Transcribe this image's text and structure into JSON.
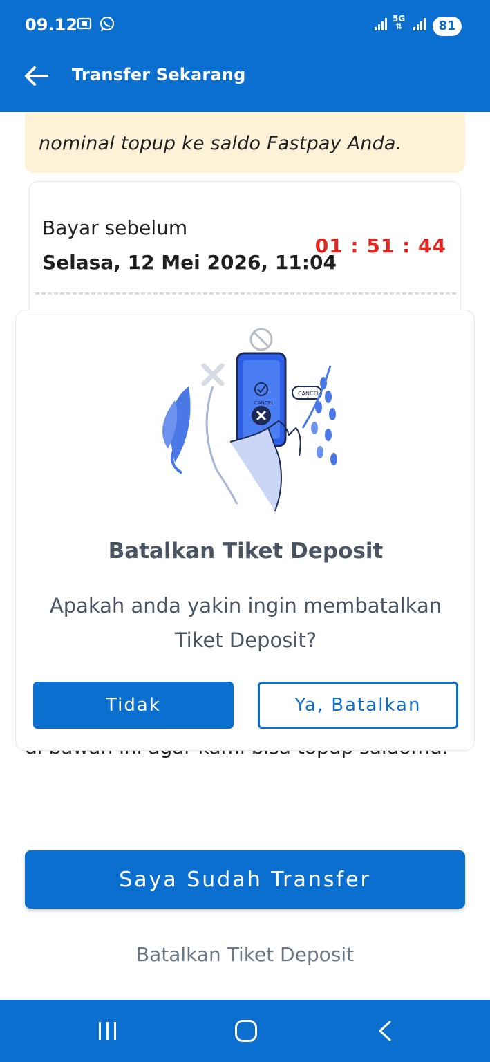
{
  "status_bar": {
    "time": "09.12",
    "network": "5G",
    "battery": "81"
  },
  "appbar": {
    "title": "Transfer Sekarang"
  },
  "warning": {
    "text": "nominal topup ke saldo Fastpay Anda."
  },
  "payment": {
    "before_label": "Bayar sebelum",
    "deadline": "Selasa, 12 Mei 2026, 11:04",
    "countdown": "01 : 51 : 44"
  },
  "instruction": {
    "text": "di bawah ini agar kami bisa topup saldomu."
  },
  "primary_button": {
    "label": "Saya Sudah Transfer"
  },
  "cancel_link": {
    "label": "Batalkan Tiket Deposit"
  },
  "modal": {
    "title": "Batalkan Tiket Deposit",
    "message": "Apakah anda yakin ingin membatalkan Tiket Deposit?",
    "no_label": "Tidak",
    "yes_label": "Ya, Batalkan",
    "illustration_label_top": "CANCEL",
    "illustration_label_screen": "CANCEL"
  },
  "colors": {
    "primary": "#0b6fcf",
    "countdown": "#e3231d",
    "warning_bg": "#fdf1d8",
    "muted": "#4a5563"
  }
}
